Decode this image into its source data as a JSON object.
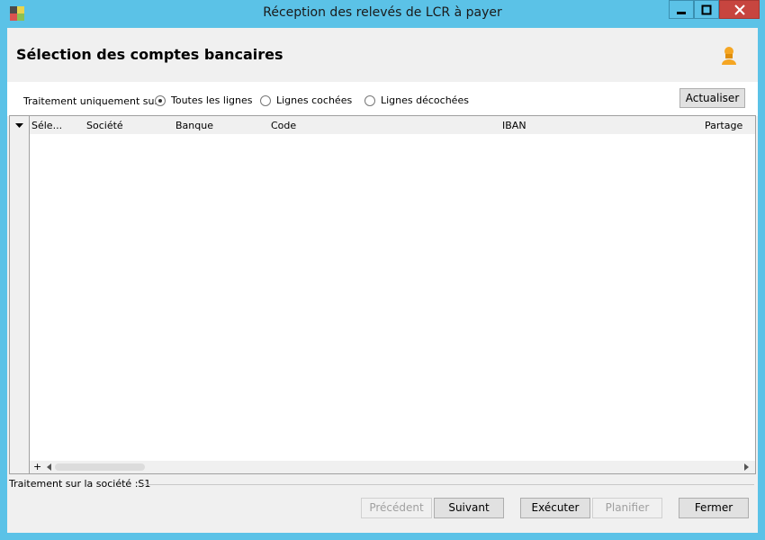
{
  "window": {
    "title": "Réception des relevés de LCR à payer",
    "controls": [
      "minimize-icon",
      "maximize-icon",
      "close-icon"
    ],
    "accent_color": "#5bc2e7",
    "close_color": "#c7453f"
  },
  "header": {
    "title": "Sélection des comptes bancaires",
    "icon": "user-icon"
  },
  "filter": {
    "label": "Traitement uniquement sur :",
    "options": [
      "Toutes les lignes",
      "Lignes cochées",
      "Lignes décochées"
    ],
    "selected": "Toutes les lignes",
    "refresh_label": "Actualiser"
  },
  "grid": {
    "columns": [
      "Séle...",
      "Société",
      "Banque",
      "Code",
      "IBAN",
      "Partage"
    ],
    "rows": [],
    "add_symbol": "+"
  },
  "status": {
    "text": "Traitement sur la société :S1"
  },
  "footer": {
    "previous": "Précédent",
    "next": "Suivant",
    "execute": "Exécuter",
    "schedule": "Planifier",
    "close": "Fermer"
  }
}
